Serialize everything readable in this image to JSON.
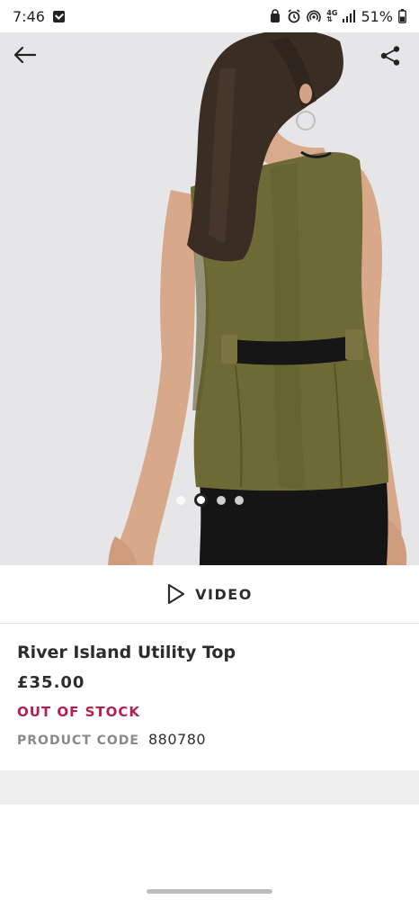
{
  "status_bar": {
    "time": "7:46",
    "battery": "51%",
    "network": "4G"
  },
  "hero": {
    "image_count": 4,
    "active_index": 1
  },
  "video": {
    "label": "VIDEO"
  },
  "product": {
    "name": "River Island Utility Top",
    "price": "£35.00",
    "stock_status": "OUT OF STOCK",
    "code_label": "PRODUCT CODE",
    "code_value": "880780"
  },
  "colors": {
    "accent_stock": "#b3204d",
    "text_primary": "#2d2d2d",
    "text_muted": "#8a8a8a",
    "top_olive": "#6e6a36"
  },
  "icons": {
    "back": "arrow-left-icon",
    "share": "share-icon",
    "video": "play-icon"
  }
}
